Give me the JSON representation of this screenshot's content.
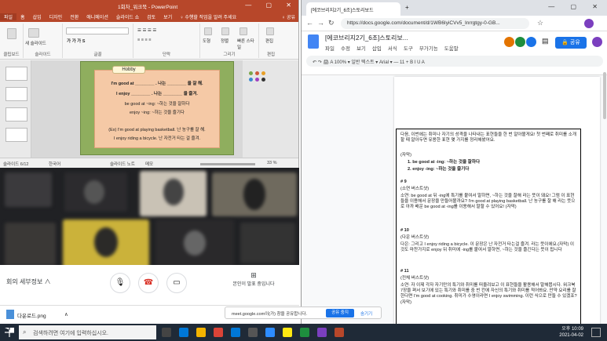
{
  "ppt": {
    "title": "1회차_워크북 - PowerPoint",
    "window_controls": "— ▢ ✕",
    "tabs": [
      "파일",
      "홈",
      "삽입",
      "디자인",
      "전환",
      "애니메이션",
      "슬라이드 쇼",
      "검토",
      "보기",
      "♀ 수행할 작업을 알려 주세요"
    ],
    "share": "♀ 공유",
    "ribbon": {
      "new_slide": "새 슬라이드",
      "groups": [
        "클립보드",
        "슬라이드",
        "글꼴",
        "단락",
        "그리기",
        "편집"
      ],
      "draw_buttons": [
        "도형",
        "정렬",
        "빠른 스타일"
      ],
      "edit_button": "편집"
    },
    "slide": {
      "tab": "Hobby",
      "line1": "I'm good at ________ . 나는 ________ 을 잘 해.",
      "line2": "I enjoy ________ . 나는 ________ 을 즐겨.",
      "line3": "be good at ~ing: ~하는 것을 잘하다",
      "line4": "enjoy ~ing: ~하는 것을 즐기다",
      "ex1": "(Ex) I'm good at playing basketball. 난 농구를 잘 해.",
      "ex2": "I enjoy riding a bicycle. 난 자전거 타는 걸 즐겨."
    },
    "status": {
      "slide_no": "슬라이드 6/12",
      "lang": "한국어",
      "notes": "슬라이드 노트",
      "memo": "메모",
      "zoom": "33 %"
    }
  },
  "chrome": {
    "tab_title": "[에코브리지2기_6조]스토리보드",
    "url": "https://docs.google.com/document/d/1WB6IyiCVv5_Inrrgtgy-0-GB...",
    "window_controls": "— ▢ ✕"
  },
  "docs": {
    "title": "[에코브리지2기_6조]스토리보...",
    "menu": [
      "파일",
      "수정",
      "보기",
      "삽입",
      "서식",
      "도구",
      "부가기능",
      "도움말"
    ],
    "share_label": "공유",
    "toolbar": "↶ ↷ 🖨 A 100% ▾   일반 텍스트 ▾   Arial ▾   —  11  +   B  I  U  A",
    "paragraphs": [
      "다음, 이번에는 취미나 자기의 성격을 나타내는 표현들을 한 번 알아볼게요! 첫 번째로 취미를 소개할 때 알아두면 유용한 표현 몇 가지를 정리해봤어요.",
      "(자막)",
      "1.    be good at -ing: ~하는 것을 잘하다",
      "2.    enjoy -ing: ~하는 것을 즐기다",
      "# 9",
      "(소연 버스트샷)",
      "소연: be good at 뒤 -ing에 특기를 붙여서 말하면, ~하는 것을 잘해 라는 뜻이 돼요! 그럼 이 표현들을 이용해서 문장을 만들어볼까요? I'm good at playing basketball. 난 농구를 잘 해 라는 뜻으로 아까 배운 be good at -ing를 이용해서 말할 수 있어요! (자막)",
      "# 10",
      "(다운 버스트샷)",
      "다은: 그리고 I enjoy riding a bicycle. 이 문장은 난 자전거 타는걸 즐겨. 라는 뜻이에요.(자막) 이것도 마찬가지로 enjoy 뒤 취미에 -ing를 붙여서 말하면, ~하는 것을 즐긴다는 뜻이 됩니다",
      "# 11",
      "(전체 버스트샷)",
      "소연: 자 이제 각자 자기만의 특기와 취미를 떠올려보고 이 표현들을 활용해서 말해봅시다. 워크북 7장을 펴서 보기에 있는 특기와 취미를 중 빈 칸에 자신의 특기와 취미를 적어봐요. 만약 요리를 잘한다면 I'm good at cooking. 취미가 수영이라면 I enjoy swimming. 이런 식으로 만들 수 있겠죠?(자막)"
    ]
  },
  "meet": {
    "info": "회의 세부정보",
    "info_chevron": "∧",
    "present": "본인이 발표 중입니다",
    "buttons": [
      "mic",
      "end-call",
      "present"
    ]
  },
  "downloads": {
    "file": "다운로드.png",
    "chevron": "∧"
  },
  "notification": {
    "text": "meet.google.com이(가) 창을 공유합니다.",
    "stop": "공유 중지",
    "hide": "숨기기"
  },
  "taskbar": {
    "search_placeholder": "검색하려면 여기에 입력하십시오.",
    "time": "오후 10:09",
    "date": "2021-04-02"
  }
}
